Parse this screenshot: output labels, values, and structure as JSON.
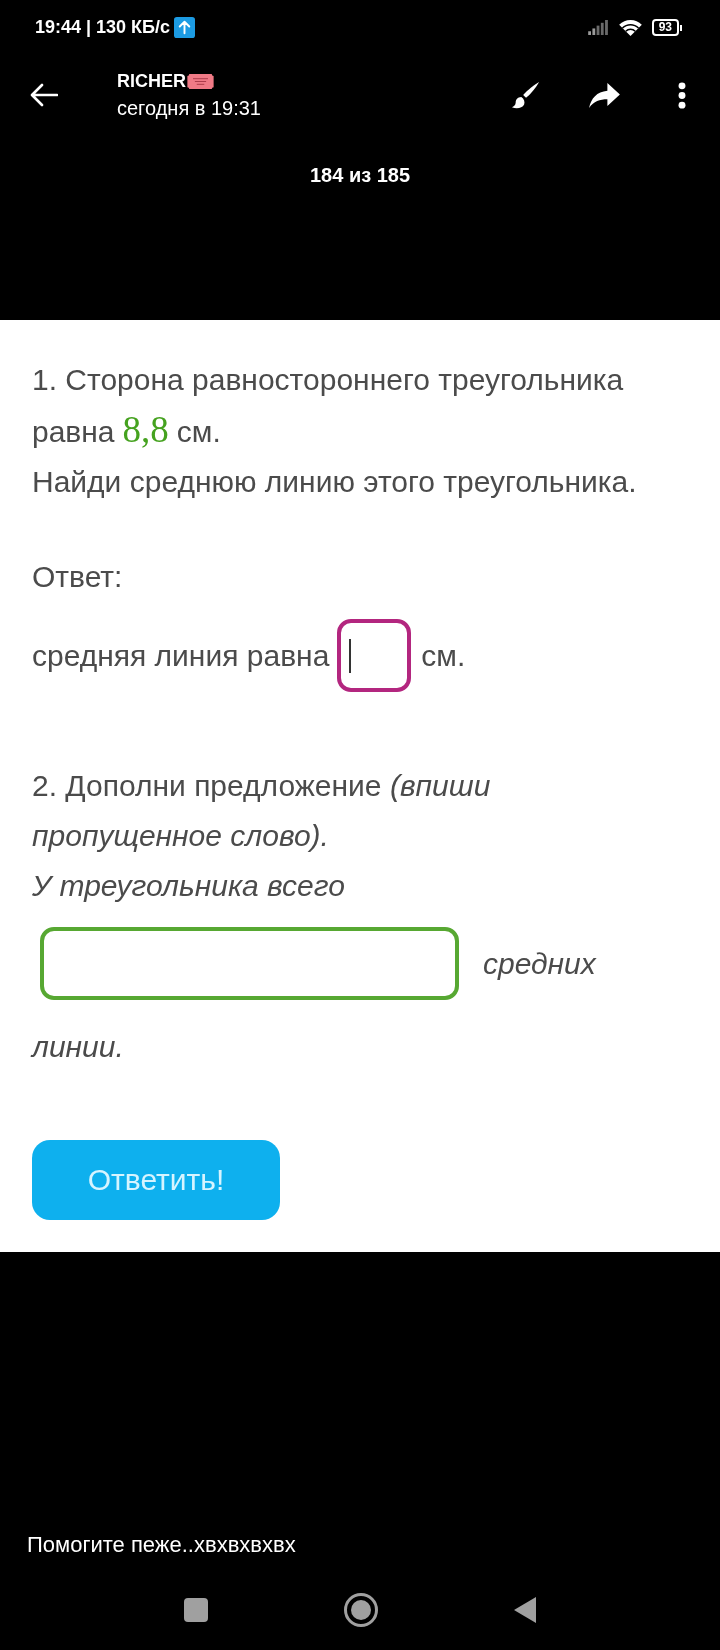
{
  "status_bar": {
    "text": "19:44 | 130 КБ/с",
    "battery_text": "93"
  },
  "header": {
    "title": "RICHER",
    "subtitle": "сегодня в 19:31",
    "counter": "184 из 185"
  },
  "question_1": {
    "segments": [
      {
        "kind": "text",
        "text": "1. Сторона равностороннего треугольника равна"
      },
      {
        "kind": "value",
        "text": "8,8"
      },
      {
        "kind": "text",
        "text": "см."
      }
    ],
    "instruction": "Найди среднюю линию этого треугольника.",
    "answer_label": "Ответ:",
    "answer": {
      "before": "средняя линия равна",
      "field": {
        "focused": true
      },
      "after": "см."
    }
  },
  "question_2": {
    "prompt": "2. Дополни предложение *(впиши пропущенное слово).*",
    "sentence": {
      "before": "У треугольника всего",
      "field": {
        "focused": false
      },
      "after": [
        "средних",
        "линии."
      ]
    }
  },
  "submit_button": "Ответить!",
  "caption": "Помогите пеже..хвхвхвхвх"
}
